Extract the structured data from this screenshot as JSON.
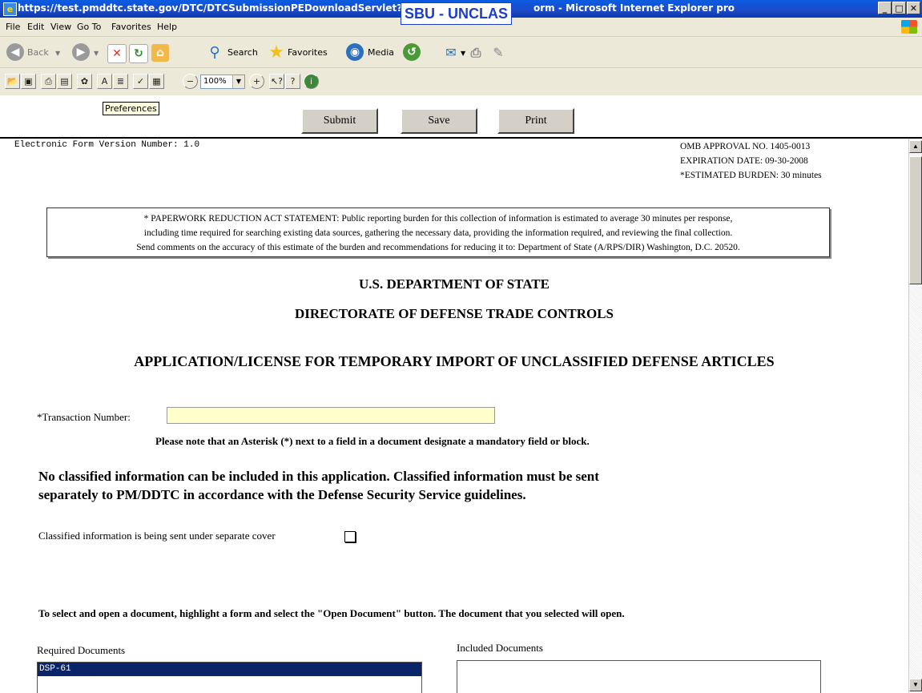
{
  "window": {
    "title_left": "https://test.pmddtc.state.gov/DTC/DTCSubmissionPEDownloadServlet?ac",
    "title_right": "orm - Microsoft Internet Explorer pro",
    "banner": "SBU - UNCLAS",
    "min": "_",
    "max": "□",
    "close": "✕"
  },
  "menu": [
    "File",
    "Edit",
    "View",
    "Go To",
    "Favorites",
    "Help"
  ],
  "toolbar": {
    "back": "Back",
    "search": "Search",
    "favorites": "Favorites",
    "media": "Media"
  },
  "formbar": {
    "zoom": "100%",
    "tooltip": "Preferences"
  },
  "actions": {
    "submit": "Submit",
    "save": "Save",
    "print": "Print"
  },
  "form": {
    "version_label": "Electronic Form Version Number:",
    "version_value": "1.0",
    "omb_approval": "OMB APPROVAL NO. 1405-0013",
    "expiration": "EXPIRATION DATE: 09-30-2008",
    "burden": "*ESTIMATED BURDEN: 30 minutes",
    "pra_line1": "* PAPERWORK REDUCTION ACT STATEMENT: Public reporting burden for this collection of information is estimated to average 30 minutes per response,",
    "pra_line2": "including time required for searching existing data sources, gathering the necessary data, providing the information required, and reviewing the final collection.",
    "pra_line3": "Send comments on the accuracy of this estimate of the burden and recommendations for reducing it to: Department of State (A/RPS/DIR) Washington, D.C. 20520.",
    "dept": "U.S. DEPARTMENT OF STATE",
    "directorate": "DIRECTORATE OF DEFENSE TRADE CONTROLS",
    "app_title": "APPLICATION/LICENSE FOR TEMPORARY IMPORT OF UNCLASSIFIED DEFENSE ARTICLES",
    "transaction_label": "*Transaction Number:",
    "transaction_value": "",
    "asterisk_note": "Please note that an Asterisk (*) next to a field in a document designate a mandatory field or block.",
    "warning_line1": "No classified information can be included in this application.  Classified information must be sent",
    "warning_line2": "separately to PM/DDTC in accordance with the Defense Security Service guidelines.",
    "classified_label": "Classified information is being sent under separate cover",
    "instructions": "To select and open a document, highlight a form and select the \"Open Document\" button.  The document that you selected will open.",
    "required_label": "Required Documents",
    "included_label": "Included Documents",
    "required_items": [
      "DSP-61"
    ]
  }
}
